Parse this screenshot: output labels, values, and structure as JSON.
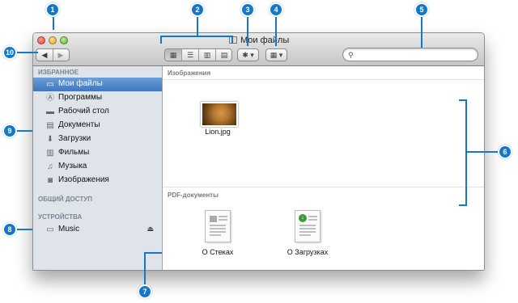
{
  "window": {
    "title": "Мои файлы"
  },
  "search": {
    "placeholder": ""
  },
  "toolbar": {
    "nav_back": "◀",
    "nav_forward": "▶",
    "views": [
      "▦",
      "☰",
      "▥",
      "▤"
    ],
    "action": "✱ ▾",
    "arrange": "▦ ▾"
  },
  "sidebar": {
    "sections": {
      "favorites": "ИЗБРАННОЕ",
      "shared": "ОБЩИЙ ДОСТУП",
      "devices": "УСТРОЙСТВА"
    },
    "items": [
      {
        "label": "Мои файлы",
        "icon": "▭"
      },
      {
        "label": "Программы",
        "icon": "Ⓐ"
      },
      {
        "label": "Рабочий стол",
        "icon": "▬"
      },
      {
        "label": "Документы",
        "icon": "▤"
      },
      {
        "label": "Загрузки",
        "icon": "⬇"
      },
      {
        "label": "Фильмы",
        "icon": "▥"
      },
      {
        "label": "Музыка",
        "icon": "♫"
      },
      {
        "label": "Изображения",
        "icon": "◙"
      }
    ],
    "devices": [
      {
        "label": "Music",
        "icon": "▭",
        "eject": "⏏"
      }
    ]
  },
  "content": {
    "groups": [
      {
        "title": "Изображения",
        "files": [
          {
            "name": "Lion.jpg"
          }
        ]
      },
      {
        "title": "PDF-документы",
        "files": [
          {
            "name": "О Стеках"
          },
          {
            "name": "О Загрузках"
          }
        ]
      }
    ]
  },
  "callouts": [
    "1",
    "2",
    "3",
    "4",
    "5",
    "6",
    "7",
    "8",
    "9",
    "10"
  ],
  "colors": {
    "callout": "#1478c8",
    "selection": "#3f76c0",
    "sidebar_bg": "#dfe4ea"
  }
}
